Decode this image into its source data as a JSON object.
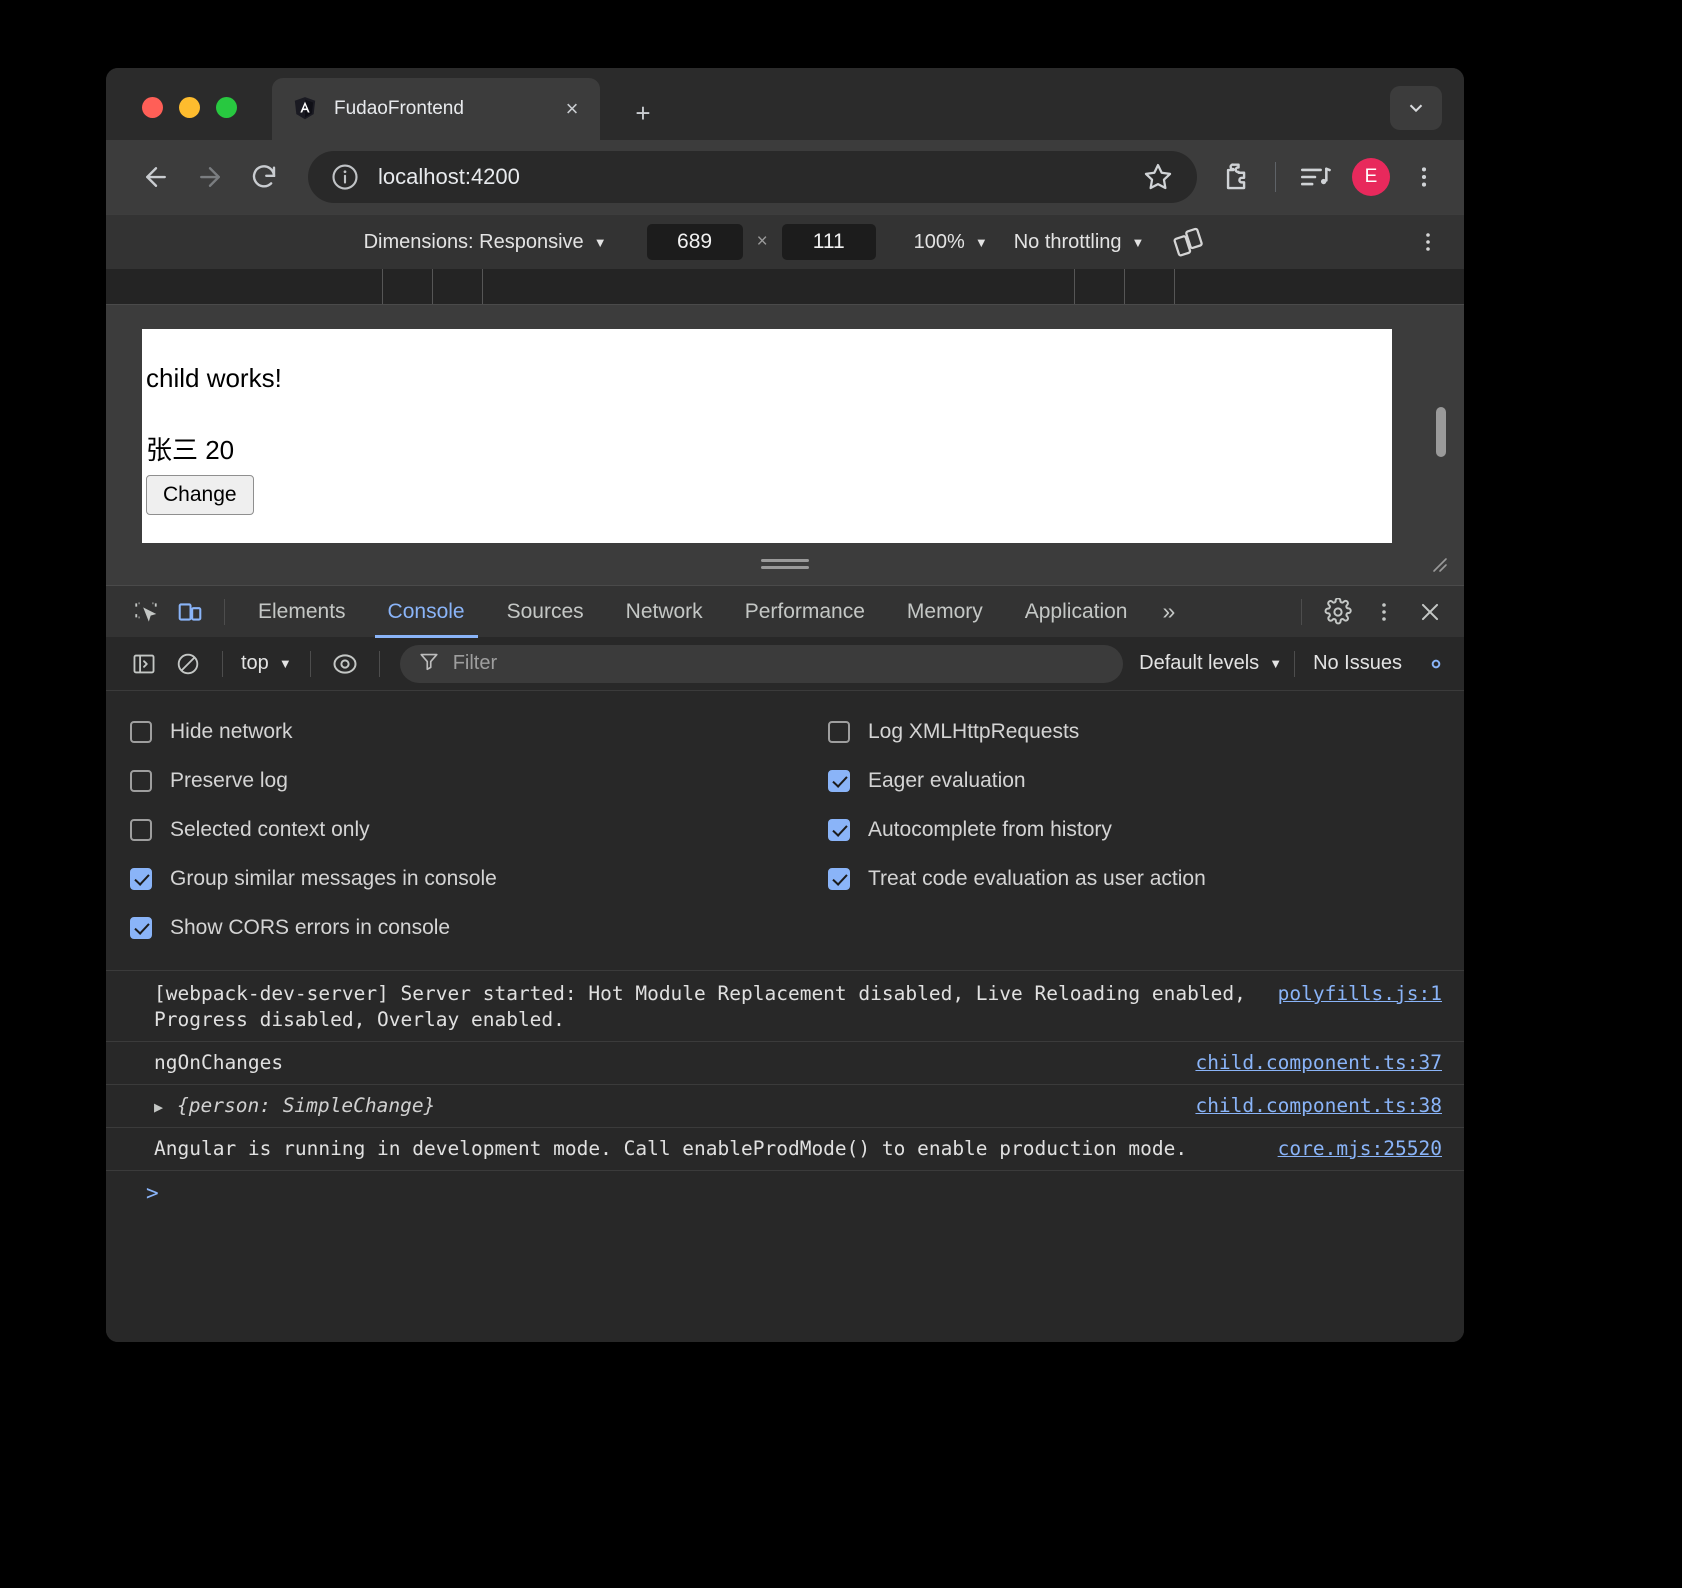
{
  "browser": {
    "tab": {
      "title": "FudaoFrontend",
      "favicon": "angular-icon",
      "close": "×"
    },
    "new_tab": "+",
    "tabstrip_dropdown": "chevron-down-icon",
    "nav": {
      "back": "back-arrow-icon",
      "forward": "forward-arrow-icon",
      "reload": "reload-icon",
      "site_info": "info-circle-icon",
      "url": "localhost:4200",
      "bookmark": "star-icon",
      "extensions": "extensions-puzzle-icon",
      "media": "media-list-icon",
      "profile_initial": "E",
      "menu": "kebab-menu-icon"
    }
  },
  "device_toolbar": {
    "dimensions_label": "Dimensions: Responsive",
    "width": "689",
    "height": "111",
    "x_symbol": "×",
    "zoom": "100%",
    "throttling": "No throttling",
    "rotate_icon": "rotate-device-icon",
    "menu_icon": "kebab-menu-icon"
  },
  "page": {
    "heading": "child works!",
    "person_line": "张三 20",
    "change_button": "Change"
  },
  "devtools": {
    "left_icons": [
      {
        "name": "inspect-element-icon"
      },
      {
        "name": "toggle-device-toolbar-icon"
      }
    ],
    "tabs": [
      {
        "label": "Elements",
        "selected": false
      },
      {
        "label": "Console",
        "selected": true
      },
      {
        "label": "Sources",
        "selected": false
      },
      {
        "label": "Network",
        "selected": false
      },
      {
        "label": "Performance",
        "selected": false
      },
      {
        "label": "Memory",
        "selected": false
      },
      {
        "label": "Application",
        "selected": false
      }
    ],
    "more_tabs": "»",
    "settings_icon": "gear-icon",
    "dock_menu_icon": "kebab-menu-icon",
    "close_icon": "close-icon",
    "console_toolbar": {
      "sidebar_icon": "console-sidebar-icon",
      "clear_icon": "clear-console-icon",
      "context": "top",
      "eye_icon": "live-expression-icon",
      "filter_icon": "filter-icon",
      "filter_placeholder": "Filter",
      "filter_value": "",
      "levels": "Default levels",
      "issues": "No Issues",
      "settings_icon": "gear-icon"
    },
    "settings": {
      "left": [
        {
          "label": "Hide network",
          "checked": false
        },
        {
          "label": "Preserve log",
          "checked": false
        },
        {
          "label": "Selected context only",
          "checked": false
        },
        {
          "label": "Group similar messages in console",
          "checked": true
        },
        {
          "label": "Show CORS errors in console",
          "checked": true
        }
      ],
      "right": [
        {
          "label": "Log XMLHttpRequests",
          "checked": false
        },
        {
          "label": "Eager evaluation",
          "checked": true
        },
        {
          "label": "Autocomplete from history",
          "checked": true
        },
        {
          "label": "Treat code evaluation as user action",
          "checked": true
        }
      ]
    },
    "messages": [
      {
        "text": "[webpack-dev-server] Server started: Hot Module Replacement disabled, Live Reloading enabled, Progress disabled, Overlay enabled.",
        "source": "polyfills.js:1",
        "kind": "log"
      },
      {
        "text": "ngOnChanges",
        "source": "child.component.ts:37",
        "kind": "log"
      },
      {
        "text": "{person: SimpleChange}",
        "source": "child.component.ts:38",
        "kind": "object",
        "expander": "▶"
      },
      {
        "text": "Angular is running in development mode. Call enableProdMode() to enable production mode.",
        "source": "core.mjs:25520",
        "kind": "log"
      }
    ],
    "prompt_symbol": ">"
  },
  "colors": {
    "accent_blue": "#8ab4f8",
    "profile_pink": "#e8295c",
    "window_bg": "#292929",
    "devtools_bg": "#282828"
  }
}
